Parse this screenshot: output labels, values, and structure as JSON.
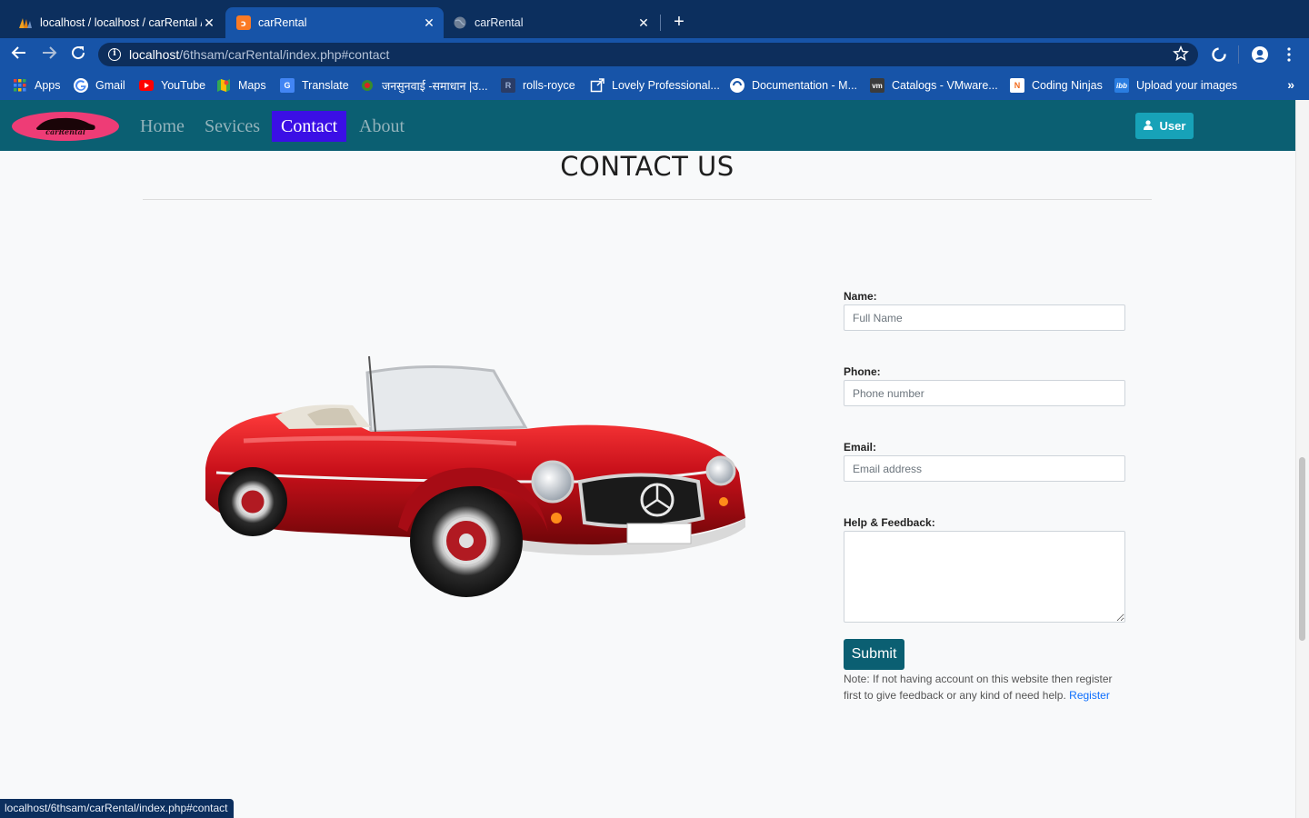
{
  "browser": {
    "tabs": [
      {
        "title": "localhost / localhost / carRental / "
      },
      {
        "title": "carRental"
      },
      {
        "title": "carRental"
      }
    ],
    "close_glyph": "✕",
    "new_tab_glyph": "+",
    "url_host": "localhost",
    "url_path": "/6thsam/carRental/index.php#contact",
    "info_glyph": "i",
    "bookmarks": [
      {
        "label": "Apps"
      },
      {
        "label": "Gmail"
      },
      {
        "label": "YouTube"
      },
      {
        "label": "Maps"
      },
      {
        "label": "Translate"
      },
      {
        "label": "जनसुनवाई -समाधान |उ..."
      },
      {
        "label": "rolls-royce"
      },
      {
        "label": "Lovely Professional..."
      },
      {
        "label": "Documentation - M..."
      },
      {
        "label": "Catalogs - VMware..."
      },
      {
        "label": "Coding Ninjas"
      },
      {
        "label": "Upload your images"
      }
    ],
    "more_glyph": "»"
  },
  "site": {
    "logo_text": "carRental",
    "nav": [
      {
        "label": "Home"
      },
      {
        "label": "Sevices"
      },
      {
        "label": "Contact"
      },
      {
        "label": "About"
      }
    ],
    "user_button": "User",
    "heading": "CONTACT US"
  },
  "form": {
    "name_label": "Name:",
    "name_placeholder": "Full Name",
    "phone_label": "Phone:",
    "phone_placeholder": "Phone number",
    "email_label": "Email:",
    "email_placeholder": "Email address",
    "feedback_label": "Help & Feedback:",
    "submit_label": "Submit",
    "note_text": "Note: If not having account on this website then register first to give feedback or any kind of need help. ",
    "register_link": "Register"
  },
  "status_url": "localhost/6thsam/carRental/index.php#contact",
  "colors": {
    "tabstrip": "#0c2f5e",
    "toolbar": "#1754a8",
    "site_nav": "#0b5f72",
    "active_nav": "#3b0fe6",
    "user_button": "#17a2b8",
    "submit": "#0b5f72",
    "car_body": "#c8101a"
  }
}
